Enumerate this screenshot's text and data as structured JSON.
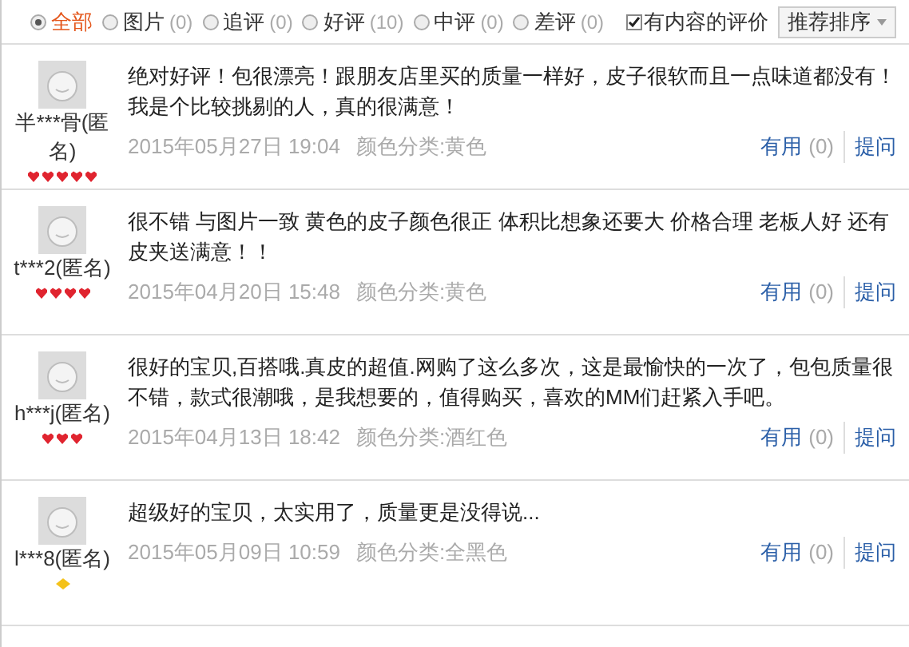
{
  "filters": [
    {
      "label": "全部",
      "selected": true
    },
    {
      "label": "图片",
      "count": "(0)",
      "selected": false
    },
    {
      "label": "追评",
      "count": "(0)",
      "selected": false
    },
    {
      "label": "好评",
      "count": "(10)",
      "selected": false
    },
    {
      "label": "中评",
      "count": "(0)",
      "selected": false
    },
    {
      "label": "差评",
      "count": "(0)",
      "selected": false
    }
  ],
  "content_only": {
    "label": "有内容的评价",
    "checked": true
  },
  "sort": {
    "value": "推荐排序"
  },
  "reviews": [
    {
      "text": "绝对好评！包很漂亮！跟朋友店里买的质量一样好，皮子很软而且一点味道都没有！我是个比较挑剔的人，真的很满意！",
      "user": "半***骨(匿名)",
      "rank": {
        "kind": "heart",
        "stars": 5
      },
      "date": "2015年05月27日 19:04",
      "sku": "颜色分类:黄色",
      "useful": "有用",
      "useful_count": "(0)",
      "ask": "提问"
    },
    {
      "text": "很不错 与图片一致 黄色的皮子颜色很正 体积比想象还要大 价格合理 老板人好 还有皮夹送满意！！",
      "user": "t***2(匿名)",
      "rank": {
        "kind": "heart",
        "stars": 4
      },
      "date": "2015年04月20日 15:48",
      "sku": "颜色分类:黄色",
      "useful": "有用",
      "useful_count": "(0)",
      "ask": "提问"
    },
    {
      "text": "很好的宝贝,百搭哦.真皮的超值.网购了这么多次，这是最愉快的一次了，包包质量很不错，款式很潮哦，是我想要的，值得购买，喜欢的MM们赶紧入手吧。",
      "user": "h***j(匿名)",
      "rank": {
        "kind": "heart",
        "stars": 3
      },
      "date": "2015年04月13日 18:42",
      "sku": "颜色分类:酒红色",
      "useful": "有用",
      "useful_count": "(0)",
      "ask": "提问"
    },
    {
      "text": "超级好的宝贝，太实用了，质量更是没得说...",
      "user": "l***8(匿名)",
      "rank": {
        "kind": "diamond"
      },
      "date": "2015年05月09日 10:59",
      "sku": "颜色分类:全黑色",
      "useful": "有用",
      "useful_count": "(0)",
      "ask": "提问"
    }
  ]
}
